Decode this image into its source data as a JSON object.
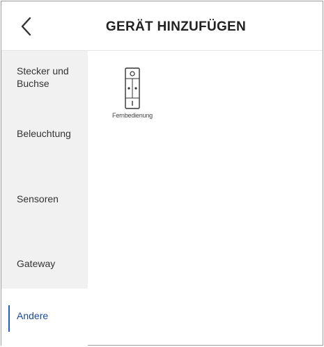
{
  "header": {
    "title": "GERÄT HINZUFÜGEN",
    "back_icon": "chevron-left-icon"
  },
  "sidebar": {
    "items": [
      {
        "label": "Stecker und Buchse",
        "active": false
      },
      {
        "label": "Beleuchtung",
        "active": false
      },
      {
        "label": "Sensoren",
        "active": false
      },
      {
        "label": "Gateway",
        "active": false
      },
      {
        "label": "Andere",
        "active": true
      }
    ]
  },
  "content": {
    "devices": [
      {
        "label": "Fernbedienung",
        "icon": "remote-control-icon"
      }
    ]
  },
  "colors": {
    "accent": "#1f5fc4",
    "sidebar_bg": "#f1f1f1",
    "active_text": "#1a4aa0"
  }
}
